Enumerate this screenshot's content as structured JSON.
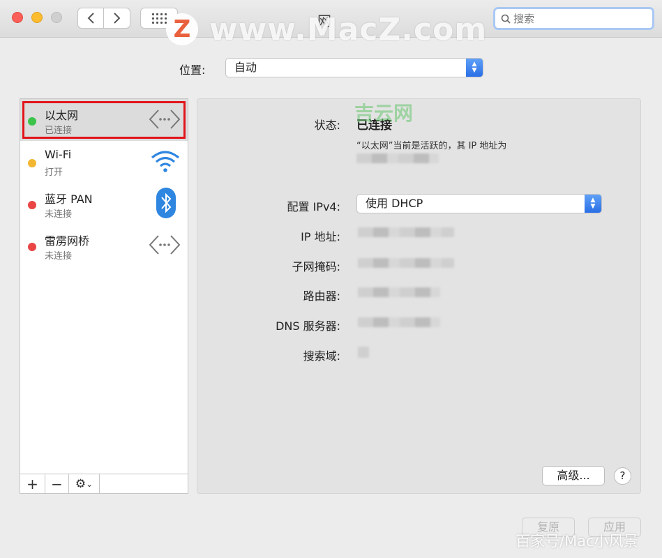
{
  "window": {
    "title": "网",
    "search_placeholder": "搜索"
  },
  "watermark": {
    "logo": "Z",
    "text": "www.MacZ.com",
    "green_text": "吉云网",
    "bottom_text": "百家号/Mac小风景"
  },
  "location": {
    "label": "位置:",
    "value": "自动"
  },
  "services": [
    {
      "name": "以太网",
      "status": "已连接",
      "dot": "#3bc34a",
      "icon": "ethernet-icon",
      "selected": true
    },
    {
      "name": "Wi-Fi",
      "status": "打开",
      "dot": "#f2b632",
      "icon": "wifi-icon"
    },
    {
      "name": "蓝牙 PAN",
      "status": "未连接",
      "dot": "#e94545",
      "icon": "bluetooth-icon"
    },
    {
      "name": "雷雳网桥",
      "status": "未连接",
      "dot": "#e94545",
      "icon": "thunderbolt-bridge-icon"
    }
  ],
  "sidebar_footer": {
    "add": "+",
    "remove": "−",
    "gear": "⚙",
    "gear_chevron": "⌄"
  },
  "detail": {
    "status_label": "状态:",
    "status_value": "已连接",
    "status_desc": "“以太网”当前是活跃的，其 IP 地址为",
    "config_label": "配置 IPv4:",
    "config_value": "使用 DHCP",
    "ip_label": "IP 地址:",
    "subnet_label": "子网掩码:",
    "router_label": "路由器:",
    "dns_label": "DNS 服务器:",
    "search_domain_label": "搜索域:",
    "advanced_label": "高级...",
    "help_label": "?"
  },
  "bottom": {
    "revert_label": "复原",
    "apply_label": "应用"
  }
}
